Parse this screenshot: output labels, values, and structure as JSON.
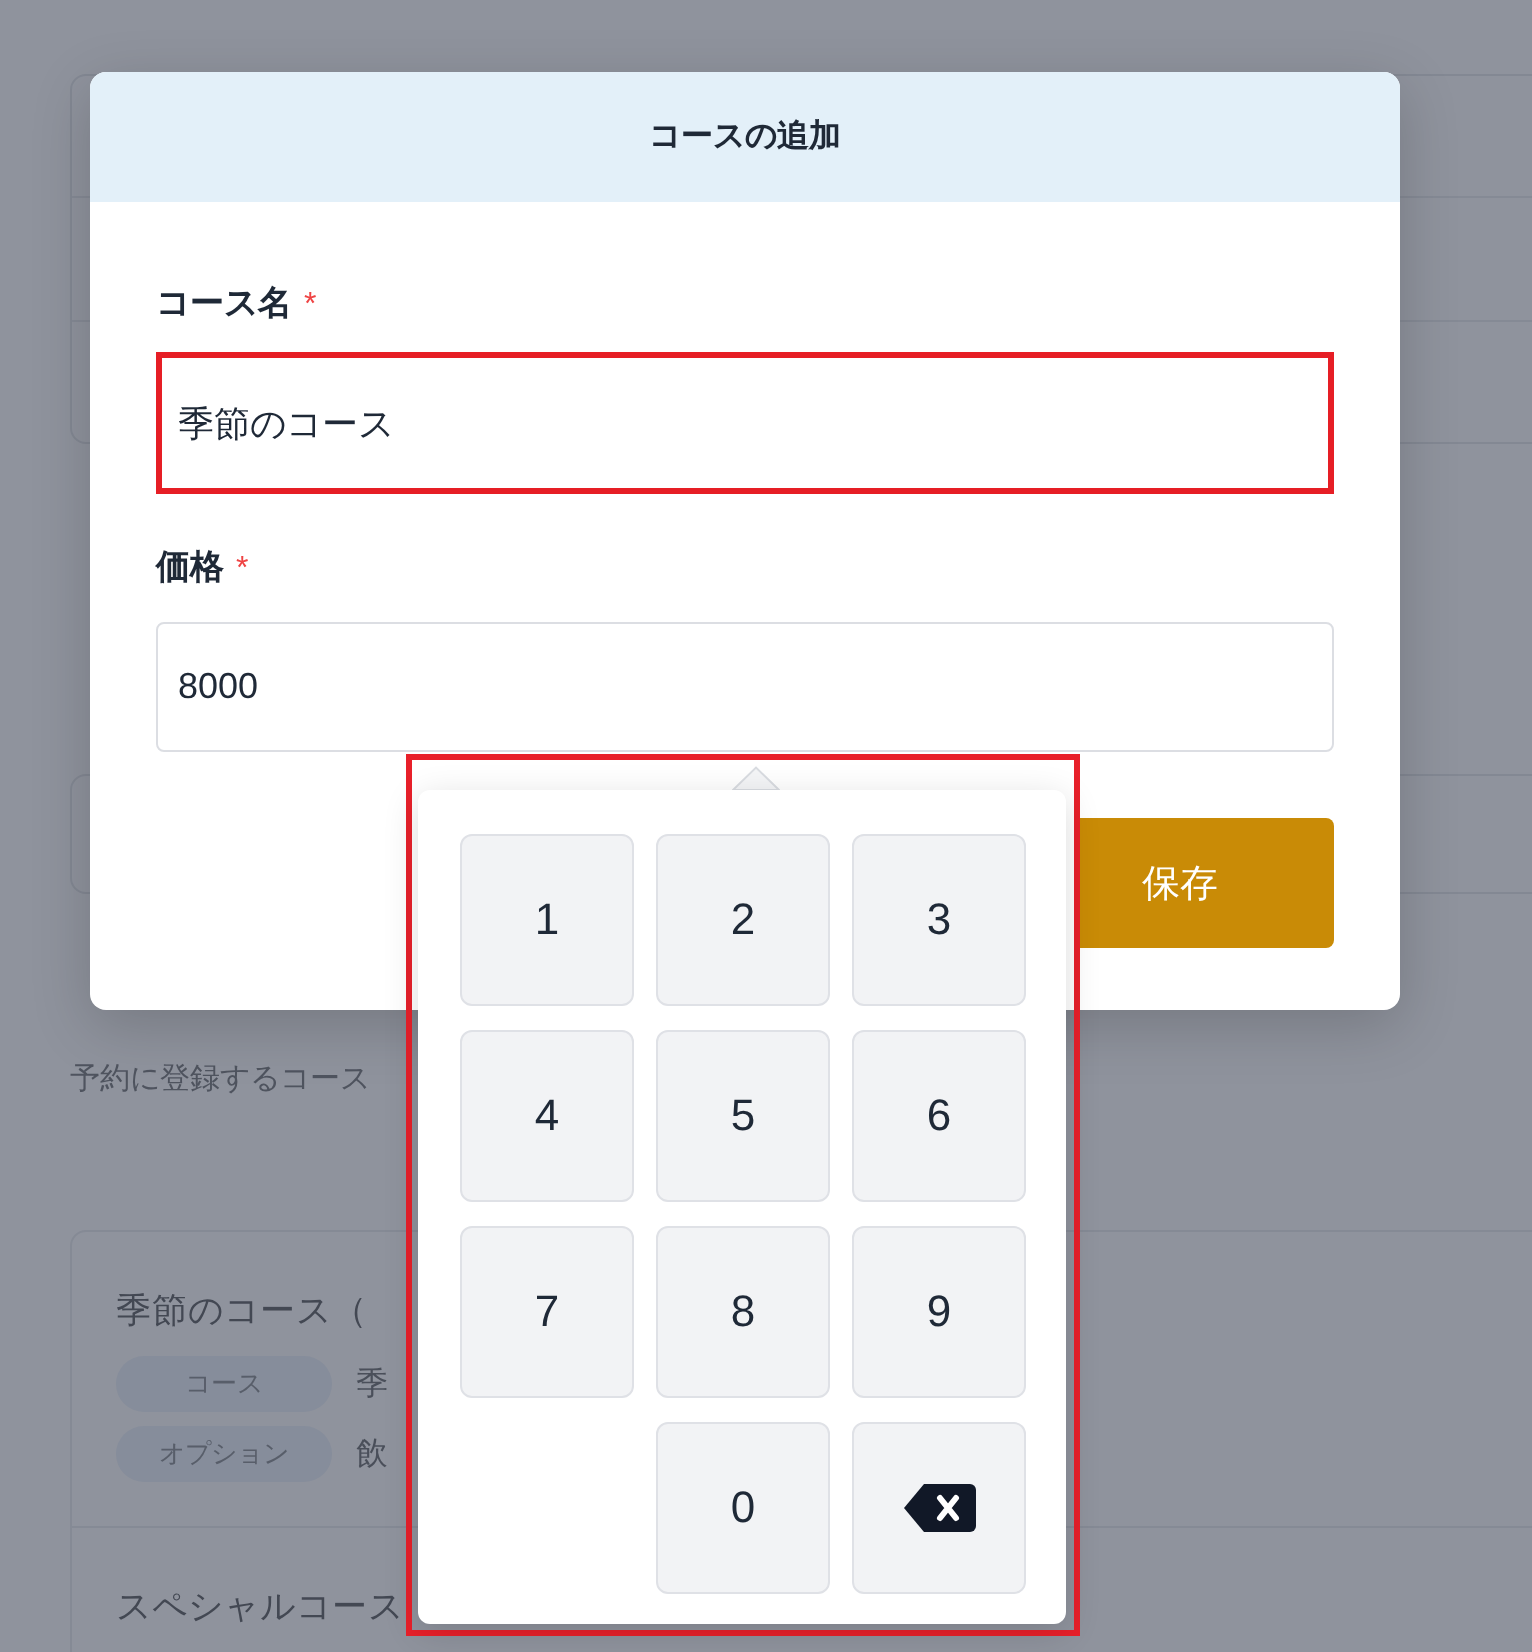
{
  "background": {
    "subtitle": "予約に登録するコース",
    "course_list": [
      {
        "name": "季節のコース（",
        "details": [
          {
            "tag": "コース",
            "value": "季"
          },
          {
            "tag": "オプション",
            "value": "飲"
          }
        ]
      },
      {
        "name": "スペシャルコース"
      }
    ]
  },
  "dialog": {
    "title": "コースの追加",
    "fields": [
      {
        "label": "コース名",
        "required_mark": "*",
        "value": "季節のコース",
        "highlighted": true
      },
      {
        "label": "価格",
        "required_mark": "*",
        "value": "8000",
        "highlighted": false
      }
    ],
    "buttons": [
      {
        "label": "保存",
        "kind": "primary"
      }
    ]
  },
  "numpad": {
    "highlighted": true,
    "keys": [
      {
        "kind": "digit",
        "label": "1"
      },
      {
        "kind": "digit",
        "label": "2"
      },
      {
        "kind": "digit",
        "label": "3"
      },
      {
        "kind": "digit",
        "label": "4"
      },
      {
        "kind": "digit",
        "label": "5"
      },
      {
        "kind": "digit",
        "label": "6"
      },
      {
        "kind": "digit",
        "label": "7"
      },
      {
        "kind": "digit",
        "label": "8"
      },
      {
        "kind": "digit",
        "label": "9"
      },
      {
        "kind": "blank"
      },
      {
        "kind": "digit",
        "label": "0"
      },
      {
        "kind": "backspace"
      }
    ]
  }
}
